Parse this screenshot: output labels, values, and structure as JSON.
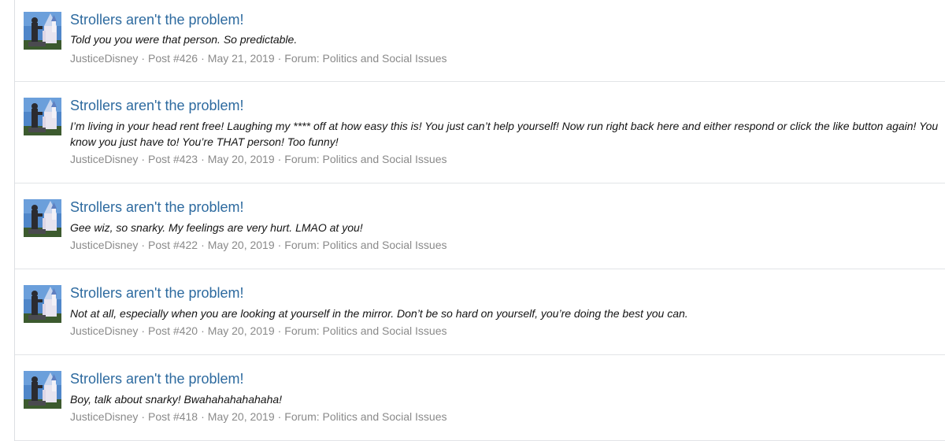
{
  "results": [
    {
      "title": "Strollers aren't the problem!",
      "snippet": "Told you you were that person. So predictable.",
      "author": "JusticeDisney",
      "post": "Post #426",
      "date": "May 21, 2019",
      "forum": "Forum: Politics and Social Issues"
    },
    {
      "title": "Strollers aren't the problem!",
      "snippet": "I’m living in your head rent free! Laughing my **** off at how easy this is! You just can’t help yourself! Now run right back here and either respond or click the like button again! You know you just have to! You’re THAT person! Too funny!",
      "author": "JusticeDisney",
      "post": "Post #423",
      "date": "May 20, 2019",
      "forum": "Forum: Politics and Social Issues"
    },
    {
      "title": "Strollers aren't the problem!",
      "snippet": "Gee wiz, so snarky. My feelings are very hurt. LMAO at you!",
      "author": "JusticeDisney",
      "post": "Post #422",
      "date": "May 20, 2019",
      "forum": "Forum: Politics and Social Issues"
    },
    {
      "title": "Strollers aren't the problem!",
      "snippet": "Not at all, especially when you are looking at yourself in the mirror. Don’t be so hard on yourself, you’re doing the best you can.",
      "author": "JusticeDisney",
      "post": "Post #420",
      "date": "May 20, 2019",
      "forum": "Forum: Politics and Social Issues"
    },
    {
      "title": "Strollers aren't the problem!",
      "snippet": "Boy, talk about snarky! Bwahahahahahaha!",
      "author": "JusticeDisney",
      "post": "Post #418",
      "date": "May 20, 2019",
      "forum": "Forum: Politics and Social Issues"
    }
  ],
  "colors": {
    "title_link": "#2d6a9f",
    "meta_text": "#8a8a8a",
    "divider": "#e2e4e7"
  },
  "icons": {
    "avatar": "castle-statue-avatar-icon"
  }
}
